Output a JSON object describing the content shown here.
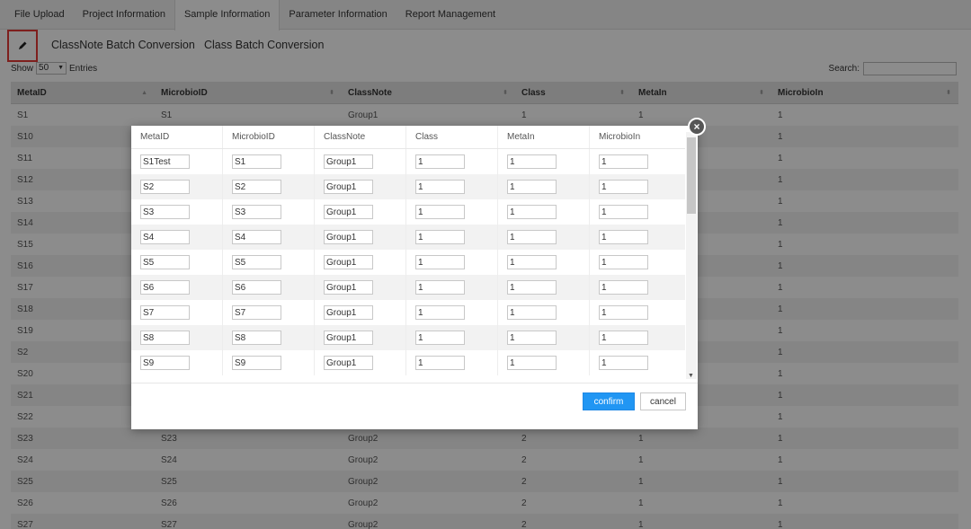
{
  "tabs": [
    {
      "label": "File Upload"
    },
    {
      "label": "Project Information"
    },
    {
      "label": "Sample Information"
    },
    {
      "label": "Parameter Information"
    },
    {
      "label": "Report Management"
    }
  ],
  "toolbar": {
    "edit_icon": "pencil-icon",
    "classnote_batch_label": "ClassNote Batch Conversion",
    "class_batch_label": "Class Batch Conversion"
  },
  "entries": {
    "show_label": "Show",
    "value": "50",
    "entries_label": "Entries"
  },
  "search": {
    "label": "Search:",
    "value": ""
  },
  "table": {
    "headers": [
      "MetaID",
      "MicrobioID",
      "ClassNote",
      "Class",
      "MetaIn",
      "MicrobioIn"
    ],
    "rows": [
      [
        "S1",
        "S1",
        "Group1",
        "1",
        "1",
        "1"
      ],
      [
        "S10",
        "",
        "",
        "",
        "",
        "1"
      ],
      [
        "S11",
        "",
        "",
        "",
        "",
        "1"
      ],
      [
        "S12",
        "",
        "",
        "",
        "",
        "1"
      ],
      [
        "S13",
        "",
        "",
        "",
        "",
        "1"
      ],
      [
        "S14",
        "",
        "",
        "",
        "",
        "1"
      ],
      [
        "S15",
        "",
        "",
        "",
        "",
        "1"
      ],
      [
        "S16",
        "",
        "",
        "",
        "",
        "1"
      ],
      [
        "S17",
        "",
        "",
        "",
        "",
        "1"
      ],
      [
        "S18",
        "",
        "",
        "",
        "",
        "1"
      ],
      [
        "S19",
        "",
        "",
        "",
        "",
        "1"
      ],
      [
        "S2",
        "",
        "",
        "",
        "",
        "1"
      ],
      [
        "S20",
        "",
        "",
        "",
        "",
        "1"
      ],
      [
        "S21",
        "",
        "",
        "",
        "",
        "1"
      ],
      [
        "S22",
        "",
        "",
        "",
        "",
        "1"
      ],
      [
        "S23",
        "S23",
        "Group2",
        "2",
        "1",
        "1"
      ],
      [
        "S24",
        "S24",
        "Group2",
        "2",
        "1",
        "1"
      ],
      [
        "S25",
        "S25",
        "Group2",
        "2",
        "1",
        "1"
      ],
      [
        "S26",
        "S26",
        "Group2",
        "2",
        "1",
        "1"
      ],
      [
        "S27",
        "S27",
        "Group2",
        "2",
        "1",
        "1"
      ]
    ]
  },
  "modal": {
    "headers": [
      "MetaID",
      "MicrobioID",
      "ClassNote",
      "Class",
      "MetaIn",
      "MicrobioIn"
    ],
    "rows": [
      [
        "S1Test",
        "S1",
        "Group1",
        "1",
        "1",
        "1"
      ],
      [
        "S2",
        "S2",
        "Group1",
        "1",
        "1",
        "1"
      ],
      [
        "S3",
        "S3",
        "Group1",
        "1",
        "1",
        "1"
      ],
      [
        "S4",
        "S4",
        "Group1",
        "1",
        "1",
        "1"
      ],
      [
        "S5",
        "S5",
        "Group1",
        "1",
        "1",
        "1"
      ],
      [
        "S6",
        "S6",
        "Group1",
        "1",
        "1",
        "1"
      ],
      [
        "S7",
        "S7",
        "Group1",
        "1",
        "1",
        "1"
      ],
      [
        "S8",
        "S8",
        "Group1",
        "1",
        "1",
        "1"
      ],
      [
        "S9",
        "S9",
        "Group1",
        "1",
        "1",
        "1"
      ]
    ],
    "confirm_label": "confirm",
    "cancel_label": "cancel",
    "close_icon": "close-icon",
    "close_glyph": "×",
    "scroll_down_glyph": "▼"
  },
  "colors": {
    "accent": "#2196f3",
    "highlight_border": "#e53935",
    "overlay": "#000000"
  }
}
